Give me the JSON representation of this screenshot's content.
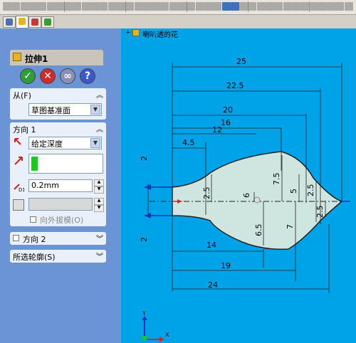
{
  "toolbar": {
    "icon_count": 40
  },
  "tabs": [
    {
      "name": "feature-manager-tab"
    },
    {
      "name": "property-manager-tab"
    },
    {
      "name": "configuration-tab"
    },
    {
      "name": "appearance-tab"
    }
  ],
  "feature": {
    "title": "拉伸1"
  },
  "confirm": {
    "ok": "✓",
    "cancel": "✕",
    "preview": "∞",
    "help": "?"
  },
  "from": {
    "label": "从(F)",
    "value": "草图基准面"
  },
  "direction1": {
    "label": "方向 1",
    "end_condition": "给定深度",
    "depth": "0.2mm",
    "draft_label": "向外拔模(O)"
  },
  "direction2": {
    "label": "方向 2"
  },
  "contours": {
    "label": "所选轮廓(S)"
  },
  "tree": {
    "label": "喇叭透的花"
  },
  "dims": {
    "d25": "25",
    "d22_5": "22.5",
    "d20": "20",
    "d16": "16",
    "d12": "12",
    "d4_5": "4.5",
    "d2a": "2",
    "d2b": "2",
    "d2_5a": "2.5",
    "d6": "6",
    "d7_5": "7.5",
    "d5": "5",
    "d2_5b": "2.5",
    "d2_5c": "2.5",
    "d6_5": "6.5",
    "d7": "7",
    "d14": "14",
    "d19": "19",
    "d24": "24"
  },
  "triad": {
    "y": "Y",
    "x": "X"
  },
  "colors": {
    "panel_bg": "#6b94d6",
    "canvas_bg": "#00a2e8",
    "sketch_fill": "#cfe6e0"
  }
}
